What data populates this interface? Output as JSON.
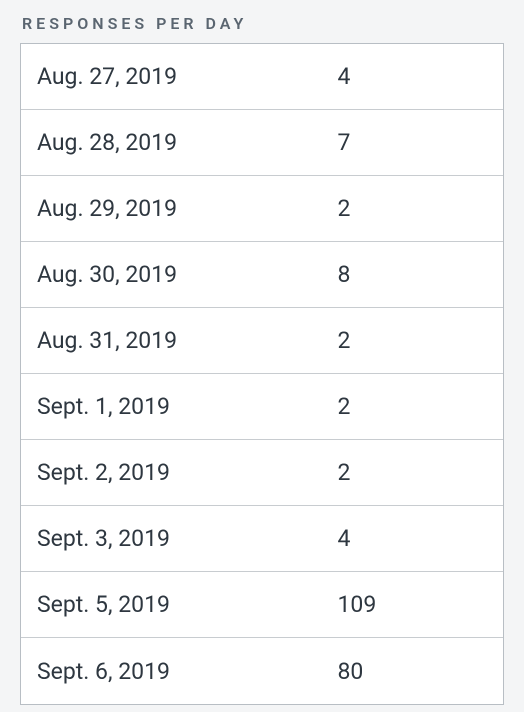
{
  "title": "RESPONSES PER DAY",
  "chart_data": {
    "type": "table",
    "columns": [
      "date",
      "count"
    ],
    "rows": [
      {
        "date": "Aug. 27, 2019",
        "count": "4"
      },
      {
        "date": "Aug. 28, 2019",
        "count": "7"
      },
      {
        "date": "Aug. 29, 2019",
        "count": "2"
      },
      {
        "date": "Aug. 30, 2019",
        "count": "8"
      },
      {
        "date": "Aug. 31, 2019",
        "count": "2"
      },
      {
        "date": "Sept. 1, 2019",
        "count": "2"
      },
      {
        "date": "Sept. 2, 2019",
        "count": "2"
      },
      {
        "date": "Sept. 3, 2019",
        "count": "4"
      },
      {
        "date": "Sept. 5, 2019",
        "count": "109"
      },
      {
        "date": "Sept. 6, 2019",
        "count": "80"
      }
    ]
  }
}
